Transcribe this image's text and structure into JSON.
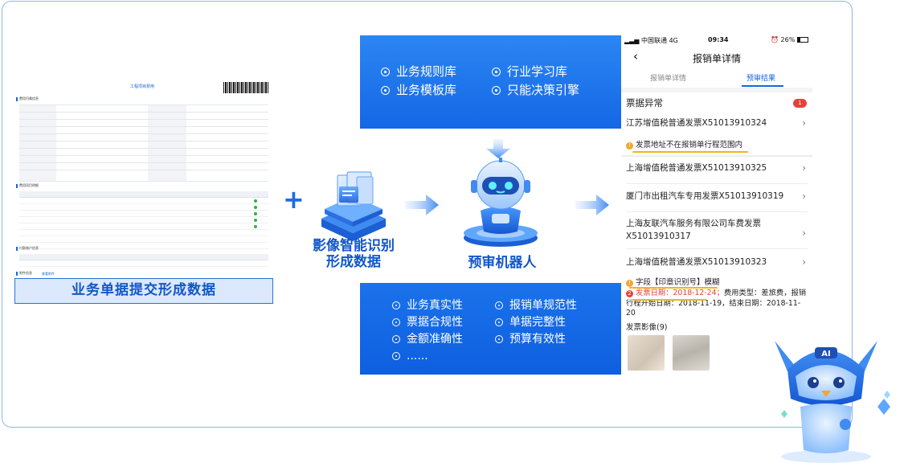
{
  "document": {
    "title": "工程项目费用",
    "section1": "费用归属信息",
    "section2": "费用项目明细",
    "section3": "付款账户信息",
    "section4": "附件信息",
    "section4_link": "查看附件",
    "banner": "业务单据提交形成数据"
  },
  "image_recognition": {
    "line1": "影像智能识别",
    "line2": "形成数据"
  },
  "rules_panel": {
    "items": [
      "业务规则库",
      "行业学习库",
      "业务模板库",
      "只能决策引擎"
    ]
  },
  "robot": {
    "label": "预审机器人"
  },
  "checks_panel": {
    "items": [
      "业务真实性",
      "报销单规范性",
      "票据合规性",
      "单据完整性",
      "金额准确性",
      "预算有效性",
      "......"
    ]
  },
  "phone": {
    "status": {
      "carrier": "中国联通",
      "network": "4G",
      "time": "09:34",
      "battery": "26%"
    },
    "title": "报销单详情",
    "tabs": [
      "报销单详情",
      "预审结果"
    ],
    "active_tab": "预审结果",
    "section_title": "票据异常",
    "badge_count": "1",
    "invoices": [
      "江苏增值税普通发票X51013910324",
      "上海增值税普通发票X51013910325",
      "厦门市出租汽车专用发票X51013910319",
      "上海友联汽车服务有限公司车费发票X51013910317",
      "上海增值税普通发票X51013910323"
    ],
    "warning1": "发票地址不在报销单行程范围内",
    "warning2": "字段【印章识别号】模糊",
    "error_text_red": "发票日期：2018-12-24；",
    "error_text_rest": "费用类型：差旅费，报销行程开始日期：2018-11-19，结束日期：2018-11-20",
    "images_label": "发票影像(9)",
    "warn_num1": "!",
    "warn_num2": "2"
  },
  "mascot": {
    "badge": "AI"
  },
  "colors": {
    "brand": "#1a66d8",
    "panel": "#1467e6",
    "warning": "#f3a72b",
    "error": "#e8403a"
  }
}
